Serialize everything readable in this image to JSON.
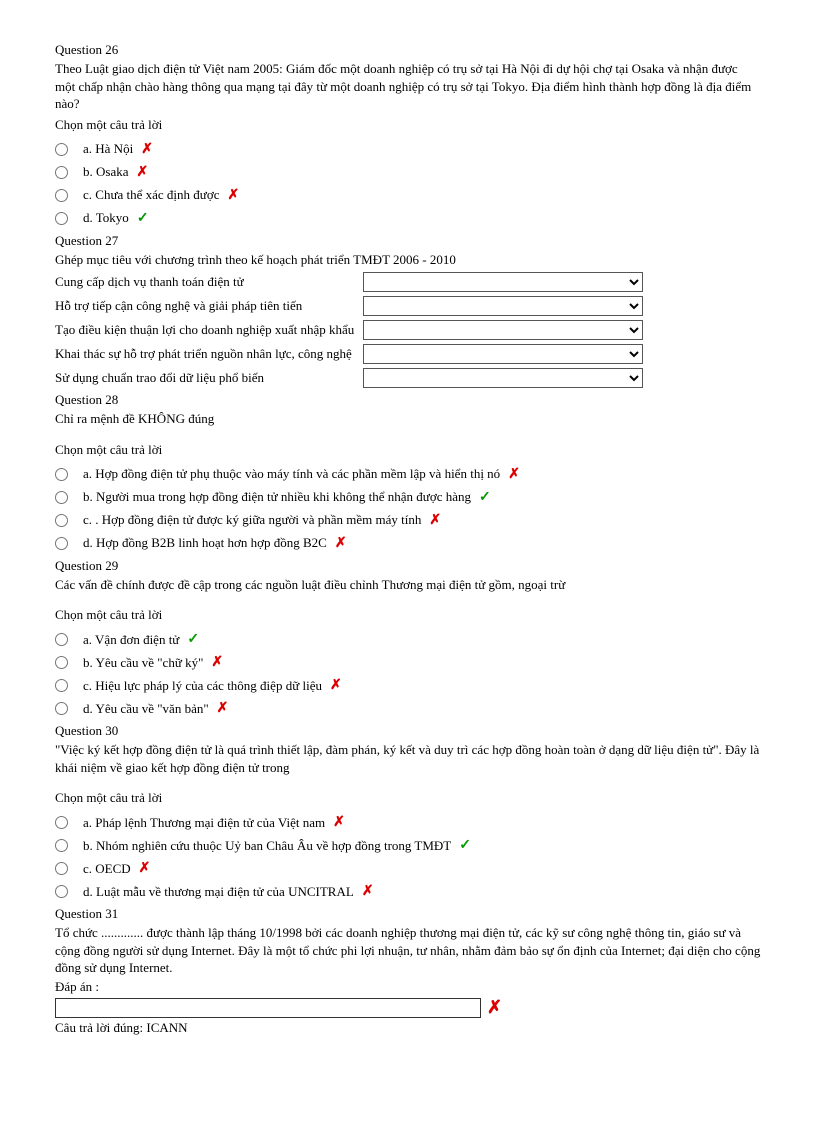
{
  "q26": {
    "title": "Question 26",
    "text": "Theo Luật giao dịch điện tử Việt nam 2005: Giám đốc một doanh nghiệp có trụ sở tại Hà Nội đi dự hội chợ tại Osaka và nhận được một chấp nhận chào hàng thông qua mạng tại đây từ một doanh nghiệp có trụ sở tại Tokyo. Địa điểm hình thành hợp đồng là địa điểm nào?",
    "instruction": "Chọn một câu trả lời",
    "options": [
      {
        "label": "a. Hà Nội",
        "mark": "wrong"
      },
      {
        "label": "b. Osaka",
        "mark": "wrong"
      },
      {
        "label": "c. Chưa thể xác định được",
        "mark": "wrong"
      },
      {
        "label": "d. Tokyo",
        "mark": "correct"
      }
    ]
  },
  "q27": {
    "title": "Question 27",
    "text": "Ghép mục tiêu với chương trình theo kế hoạch phát triển TMĐT 2006 - 2010",
    "rows": [
      "Cung cấp dịch vụ thanh toán điện tử",
      "Hỗ trợ tiếp cận công nghệ và giải pháp tiên tiến",
      "Tạo điều kiện thuận lợi cho doanh nghiệp xuất nhập khẩu",
      "Khai thác sự hỗ trợ phát triển nguồn nhân lực, công nghệ",
      "Sử dụng chuẩn trao đổi dữ liệu phổ biến"
    ]
  },
  "q28": {
    "title": "Question 28",
    "text": "Chỉ ra mệnh đề KHÔNG đúng",
    "instruction": "Chọn một câu trả lời",
    "options": [
      {
        "label": "a. Hợp đồng điện tử phụ thuộc vào máy tính và các phần mềm lập và hiển thị nó",
        "mark": "wrong"
      },
      {
        "label": "b. Người mua trong hợp đồng điện tử nhiều khi không thể nhận được hàng",
        "mark": "correct"
      },
      {
        "label": "c. . Hợp đồng điện tử được ký giữa người và phần mềm máy tính",
        "mark": "wrong"
      },
      {
        "label": "d. Hợp đồng B2B linh hoạt hơn hợp đồng B2C",
        "mark": "wrong"
      }
    ]
  },
  "q29": {
    "title": "Question 29",
    "text": "Các vấn đề chính được đề cập trong các nguồn luật điều chỉnh Thương mại điện tử gồm, ngoại trừ",
    "instruction": "Chọn một câu trả lời",
    "options": [
      {
        "label": "a. Vận đơn điện tử",
        "mark": "correct"
      },
      {
        "label": "b. Yêu cầu về \"chữ ký\"",
        "mark": "wrong"
      },
      {
        "label": "c. Hiệu lực pháp lý của các thông điệp dữ liệu",
        "mark": "wrong"
      },
      {
        "label": "d. Yêu cầu về \"văn bản\"",
        "mark": "wrong"
      }
    ]
  },
  "q30": {
    "title": "Question 30",
    "text": "\"Việc ký kết hợp đồng điện tử là quá trình thiết lập, đàm phán, ký kết và duy trì các hợp đồng hoàn toàn ở dạng dữ liệu điện tử\". Đây là khái niệm về giao kết hợp đồng điện tử trong",
    "instruction": "Chọn một câu trả lời",
    "options": [
      {
        "label": "a. Pháp lệnh Thương mại điện tử của Việt nam",
        "mark": "wrong"
      },
      {
        "label": "b. Nhóm nghiên cứu thuộc Uỷ ban Châu Âu về hợp đồng trong TMĐT",
        "mark": "correct"
      },
      {
        "label": "c. OECD",
        "mark": "wrong"
      },
      {
        "label": "d. Luật mẫu về thương mại điện tử của UNCITRAL",
        "mark": "wrong"
      }
    ]
  },
  "q31": {
    "title": "Question 31",
    "text": "Tổ chức ............. được thành lập tháng 10/1998 bởi các doanh nghiệp thương mại điện tử, các kỹ sư công nghệ thông tin, giáo sư và cộng đồng người sử dụng Internet. Đây là một tổ chức phi lợi nhuận, tư nhân, nhằm đảm bảo sự ổn định của Internet; đại diện cho cộng đồng sử dụng Internet.",
    "answer_label": "Đáp án :",
    "correct": "Câu trả lời đúng: ICANN"
  },
  "marks": {
    "wrong": "✗",
    "correct": "✓"
  }
}
